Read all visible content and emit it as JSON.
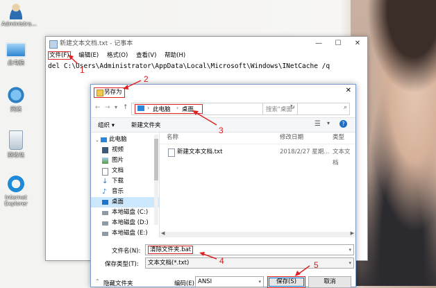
{
  "desktop": {
    "icons": [
      {
        "label": "Administra...",
        "icon": "user-icon"
      },
      {
        "label": "此电脑",
        "icon": "computer-icon"
      },
      {
        "label": "网络",
        "icon": "network-icon"
      },
      {
        "label": "回收站",
        "icon": "recycle-bin-icon"
      },
      {
        "label": "Internet Explorer",
        "icon": "ie-icon"
      }
    ]
  },
  "notepad": {
    "title": "新建文本文档.txt - 记事本",
    "menu": [
      "文件(F)",
      "编辑(E)",
      "格式(O)",
      "查看(V)",
      "帮助(H)"
    ],
    "content": "del C:\\Users\\Administrator\\AppData\\Local\\Microsoft\\Windows\\INetCache /q"
  },
  "dialog": {
    "title": "另存为",
    "breadcrumb": [
      "此电脑",
      "桌面"
    ],
    "search_placeholder": "搜索\"桌面\"",
    "toolbar": {
      "organize": "组织 ▾",
      "new_folder": "新建文件夹"
    },
    "nav": [
      {
        "label": "此电脑",
        "icon": "computer-icon"
      },
      {
        "label": "视频",
        "icon": "video-icon"
      },
      {
        "label": "图片",
        "icon": "picture-icon"
      },
      {
        "label": "文档",
        "icon": "document-icon"
      },
      {
        "label": "下载",
        "icon": "download-icon"
      },
      {
        "label": "音乐",
        "icon": "music-icon"
      },
      {
        "label": "桌面",
        "icon": "desktop-icon",
        "selected": true
      },
      {
        "label": "本地磁盘 (C:)",
        "icon": "drive-icon"
      },
      {
        "label": "本地磁盘 (D:)",
        "icon": "drive-icon"
      },
      {
        "label": "本地磁盘 (E:)",
        "icon": "drive-icon"
      }
    ],
    "columns": {
      "name": "名称",
      "modified": "修改日期",
      "type": "类型"
    },
    "files": [
      {
        "name": "新建文本文档.txt",
        "modified": "2018/2/27 星期...",
        "type": "文本文档"
      }
    ],
    "filename_label": "文件名(N):",
    "filename_value": "清除文件夹.bat",
    "filetype_label": "保存类型(T):",
    "filetype_value": "文本文档(*.txt)",
    "hide_folders": "隐藏文件夹",
    "encoding_label": "编码(E):",
    "encoding_value": "ANSI",
    "save": "保存(S)",
    "cancel": "取消"
  },
  "annotations": [
    "1",
    "2",
    "3",
    "4",
    "5"
  ],
  "colors": {
    "annotation": "#e02020",
    "selected": "#cce8ff",
    "accent": "#0078d7"
  }
}
